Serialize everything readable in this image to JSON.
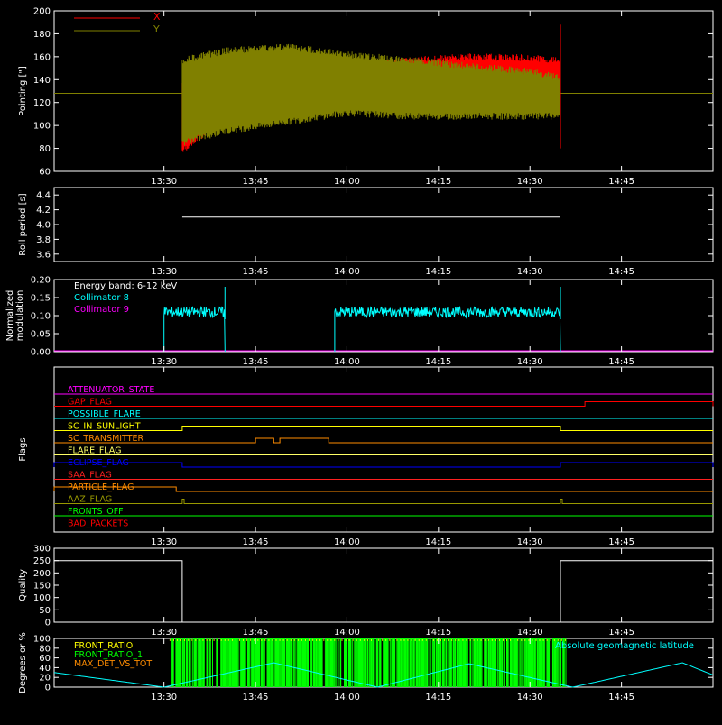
{
  "chart_data": [
    {
      "type": "line",
      "ylabel": "Pointing [\"]",
      "ylim": [
        60,
        200
      ],
      "y_ticks": [
        "60",
        "80",
        "100",
        "120",
        "140",
        "160",
        "180",
        "200"
      ],
      "x_ticks": [
        "13:30",
        "13:45",
        "14:00",
        "14:15",
        "14:30",
        "14:45"
      ],
      "legend": [
        {
          "name": "X",
          "color": "#ff0000"
        },
        {
          "name": "Y",
          "color": "#808000"
        }
      ],
      "baseline_value": 128,
      "data_start": "13:33",
      "data_end": "14:35",
      "series": [
        {
          "name": "X",
          "color": "#ff0000",
          "x": [
            "13:33",
            "13:40",
            "13:50",
            "14:00",
            "14:10",
            "14:20",
            "14:30",
            "14:35"
          ],
          "upper": [
            140,
            146,
            150,
            152,
            160,
            163,
            162,
            160
          ],
          "lower": [
            75,
            103,
            112,
            118,
            125,
            126,
            127,
            128
          ]
        },
        {
          "name": "Y",
          "color": "#808000",
          "x": [
            "13:33",
            "13:40",
            "13:50",
            "14:00",
            "14:10",
            "14:20",
            "14:30",
            "14:35"
          ],
          "upper": [
            160,
            168,
            172,
            165,
            160,
            155,
            150,
            145
          ],
          "lower": [
            82,
            92,
            100,
            108,
            105,
            105,
            105,
            105
          ]
        }
      ]
    },
    {
      "type": "line",
      "ylabel": "Roll period [s]",
      "ylim": [
        3.5,
        4.5
      ],
      "y_ticks": [
        "3.6",
        "3.8",
        "4.0",
        "4.2",
        "4.4"
      ],
      "x_ticks": [
        "13:30",
        "13:45",
        "14:00",
        "14:15",
        "14:30",
        "14:45"
      ],
      "series": [
        {
          "name": "Roll period",
          "value": 4.1,
          "color": "#ffffff"
        }
      ]
    },
    {
      "type": "line",
      "ylabel": "Normalized modulation",
      "ylim": [
        0,
        0.2
      ],
      "y_ticks": [
        "0.00",
        "0.05",
        "0.10",
        "0.15",
        "0.20"
      ],
      "x_ticks": [
        "13:30",
        "13:45",
        "14:00",
        "14:15",
        "14:30",
        "14:45"
      ],
      "annotation": "Energy band: 6-12 keV",
      "legend": [
        {
          "name": "Collimator 8",
          "color": "#00ffff"
        },
        {
          "name": "Collimator 9",
          "color": "#ff00ff"
        }
      ],
      "segments": [
        {
          "start": "13:30",
          "end": "13:40",
          "mean": 0.11
        },
        {
          "start": "13:58",
          "end": "14:35",
          "mean": 0.11
        }
      ]
    },
    {
      "type": "line",
      "ylabel": "Flags",
      "x_ticks": [
        "13:30",
        "13:45",
        "14:00",
        "14:15",
        "14:30",
        "14:45"
      ],
      "flags": [
        {
          "name": "ATTENUATOR_STATE",
          "color": "#ff00ff",
          "high": []
        },
        {
          "name": "GAP_FLAG",
          "color": "#ff0000",
          "high": [
            [
              "14:39",
              "15:00"
            ]
          ],
          "pre_high": [
            [
              "13:12",
              "13:31"
            ]
          ]
        },
        {
          "name": "POSSIBLE_FLARE",
          "color": "#00ffff",
          "high": []
        },
        {
          "name": "SC_IN_SUNLIGHT",
          "color": "#ffff00",
          "high": [
            [
              "13:33",
              "14:35"
            ]
          ]
        },
        {
          "name": "SC_TRANSMITTER",
          "color": "#ff8c00",
          "high": [
            [
              "13:45",
              "13:48"
            ],
            [
              "13:49",
              "13:57"
            ]
          ]
        },
        {
          "name": "FLARE_FLAG",
          "color": "#ffff66",
          "high": []
        },
        {
          "name": "ECLIPSE_FLAG",
          "color": "#0000ff",
          "high": [
            [
              "13:12",
              "13:33"
            ],
            [
              "14:35",
              "15:00"
            ]
          ]
        },
        {
          "name": "SAA_FLAG",
          "color": "#ff2020",
          "high": []
        },
        {
          "name": "PARTICLE_FLAG",
          "color": "#ff8c00",
          "high": [
            [
              "13:12",
              "13:32"
            ]
          ]
        },
        {
          "name": "AAZ_FLAG",
          "color": "#999900",
          "high": [
            [
              "13:33",
              "13:33.3"
            ],
            [
              "14:35",
              "14:35.3"
            ]
          ]
        },
        {
          "name": "FRONTS_OFF",
          "color": "#00ff00",
          "high": []
        },
        {
          "name": "BAD_PACKETS",
          "color": "#ff0000",
          "high": []
        }
      ]
    },
    {
      "type": "line",
      "ylabel": "Quality",
      "ylim": [
        0,
        300
      ],
      "y_ticks": [
        "0",
        "50",
        "100",
        "150",
        "200",
        "250",
        "300"
      ],
      "x_ticks": [
        "13:30",
        "13:45",
        "14:00",
        "14:15",
        "14:30",
        "14:45"
      ],
      "series": [
        {
          "name": "Quality",
          "x": [
            "13:12",
            "13:33",
            "13:33",
            "14:35",
            "14:35",
            "15:00"
          ],
          "y": [
            250,
            250,
            0,
            0,
            250,
            250
          ],
          "color": "#ffffff"
        }
      ]
    },
    {
      "type": "line",
      "ylabel": "Degrees or %",
      "ylim": [
        0,
        100
      ],
      "y_ticks": [
        "0",
        "20",
        "40",
        "60",
        "80",
        "100"
      ],
      "x_ticks": [
        "13:30",
        "13:45",
        "14:00",
        "14:15",
        "14:30",
        "14:45"
      ],
      "legend": [
        {
          "name": "FRONT_RATIO",
          "color": "#ffff00"
        },
        {
          "name": "FRONT_RATIO_1",
          "color": "#00ff00"
        },
        {
          "name": "MAX_DET_VS_TOT",
          "color": "#ff8c00"
        },
        {
          "name": "Absolute geomagnetic latitude",
          "color": "#00ffff"
        }
      ],
      "series": [
        {
          "name": "Absolute geomagnetic latitude",
          "color": "#00ffff",
          "x": [
            "13:12",
            "13:30",
            "13:48",
            "14:05",
            "14:20",
            "14:37",
            "14:55",
            "15:00"
          ],
          "y": [
            30,
            0,
            50,
            0,
            48,
            0,
            50,
            25
          ]
        }
      ],
      "bursts": {
        "start": "13:31",
        "end": "14:36",
        "color": "#00ff00"
      }
    }
  ]
}
